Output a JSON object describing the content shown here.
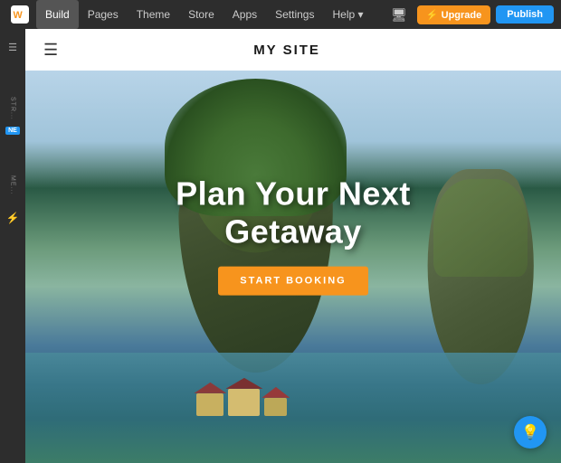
{
  "topbar": {
    "logo_alt": "Weebly logo",
    "nav_items": [
      {
        "label": "Build",
        "active": true
      },
      {
        "label": "Pages",
        "active": false
      },
      {
        "label": "Theme",
        "active": false
      },
      {
        "label": "Store",
        "active": false
      },
      {
        "label": "Apps",
        "active": false
      },
      {
        "label": "Settings",
        "active": false
      },
      {
        "label": "Help ▾",
        "active": false
      }
    ],
    "upgrade_label": "⚡ Upgrade",
    "publish_label": "Publish",
    "preview_icon": "🖥"
  },
  "sidebar": {
    "items": [
      {
        "label": "≡",
        "name": "menu"
      },
      {
        "label": "STR...",
        "name": "structure"
      },
      {
        "label": "NE",
        "name": "new-badge"
      },
      {
        "label": "ME...",
        "name": "media"
      },
      {
        "label": "⚡",
        "name": "flash"
      }
    ]
  },
  "site": {
    "header_hamburger": "☰",
    "title": "MY SITE"
  },
  "hero": {
    "title_line1": "Plan Your Next",
    "title_line2": "Getaway",
    "cta_label": "START BOOKING"
  },
  "fab": {
    "icon": "💡"
  }
}
